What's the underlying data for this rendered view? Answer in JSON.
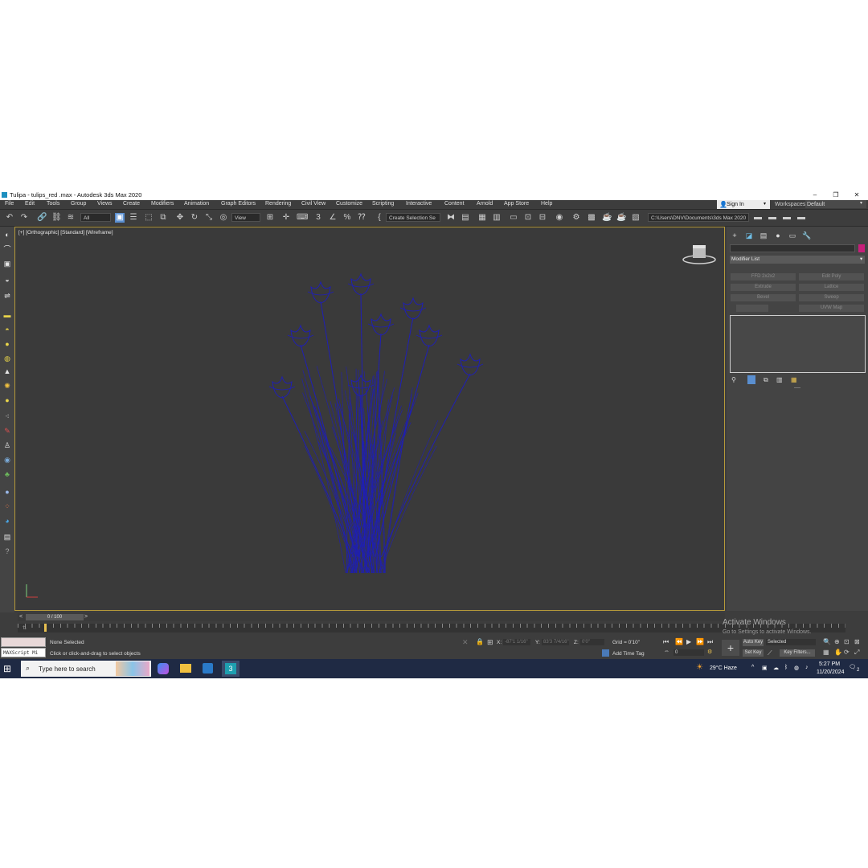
{
  "window": {
    "title": "Tulipa - tulips_red .max - Autodesk 3ds Max 2020",
    "controls": [
      "–",
      "❐",
      "✕"
    ]
  },
  "menu": [
    "File",
    "Edit",
    "Tools",
    "Group",
    "Views",
    "Create",
    "Modifiers",
    "Animation",
    "Graph Editors",
    "Rendering",
    "Civil View",
    "Customize",
    "Scripting",
    "Interactive",
    "Content",
    "Arnold",
    "App Store",
    "Help"
  ],
  "account": {
    "sign_in": "Sign In",
    "workspaces_label": "Workspaces:",
    "workspace": "Default"
  },
  "toolbar": {
    "filter": "All",
    "ref_coord": "View",
    "selection_set": "Create Selection Se",
    "project_path": "C:\\Users\\DNV\\Documents\\3ds Max 2020"
  },
  "viewport": {
    "label": "[+] [Orthographic] [Standard] [Wireframe]",
    "wire_color": "#1f1fb5",
    "border_color": "#b69a3a"
  },
  "command_panel": {
    "modifier_list": "Modifier List",
    "object_color": "#c81e7a",
    "modifier_buttons": [
      "FFD 2x2x2",
      "Edit Poly",
      "Extrude",
      "Lattice",
      "Bevel",
      "Sweep",
      "",
      "UVW Map"
    ]
  },
  "timeline": {
    "frame": "0 / 100"
  },
  "status": {
    "maxscript": "MAXScript Mi",
    "selection": "None Selected",
    "prompt": "Click or click-and-drag to select objects",
    "x_label": "X:",
    "x_value": "-87'1 1/16\"",
    "y_label": "Y:",
    "y_value": "83'3 7/4/16\"",
    "z_label": "Z:",
    "z_value": "0'0\"",
    "grid": "Grid = 0'10\"",
    "add_time_tag": "Add Time Tag",
    "auto_key": "Auto Key",
    "set_key": "Set Key",
    "selected": "Selected",
    "key_filters": "Key Filters...",
    "current_frame": "0"
  },
  "watermark": {
    "title": "Activate Windows",
    "subtitle": "Go to Settings to activate Windows."
  },
  "taskbar": {
    "search_placeholder": "Type here to search",
    "weather": "29°C  Haze",
    "time": "5:27 PM",
    "date": "11/20/2024",
    "notifications": "2"
  }
}
